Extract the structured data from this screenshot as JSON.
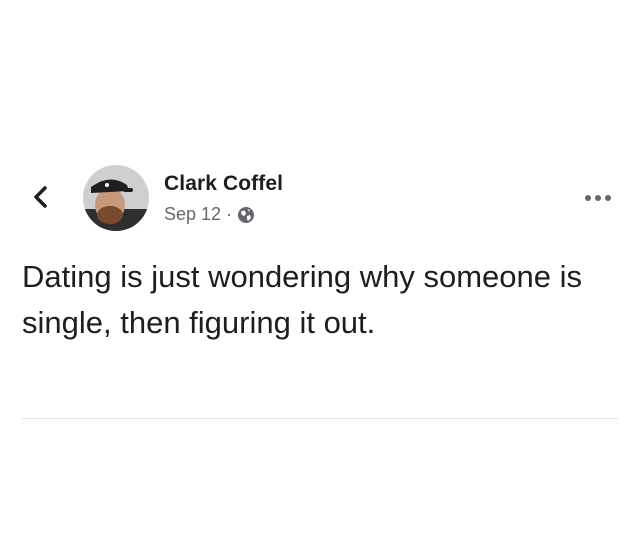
{
  "post": {
    "author": "Clark Coffel",
    "date": "Sep 12",
    "separator": "·",
    "privacy_icon": "globe-icon",
    "text": "Dating is just wondering why someone is single, then figuring it out."
  },
  "icons": {
    "back": "chevron-left-icon",
    "more": "more-horizontal-icon"
  },
  "colors": {
    "text_primary": "#1c1e21",
    "text_secondary": "#65676b",
    "background": "#ffffff"
  }
}
